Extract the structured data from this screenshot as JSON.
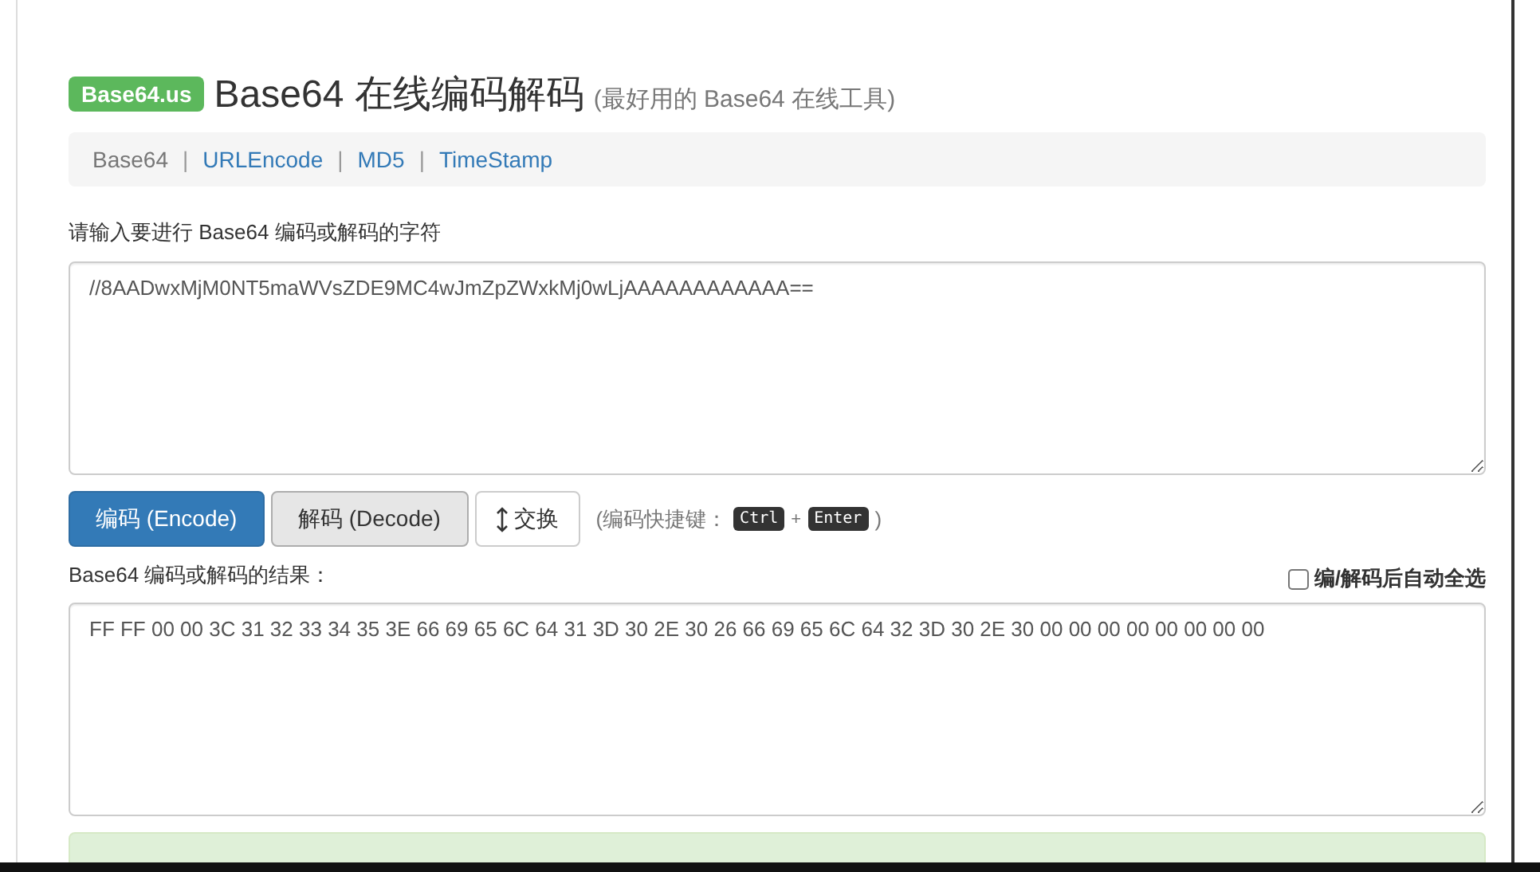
{
  "header": {
    "badge": "Base64.us",
    "title": "Base64 在线编码解码",
    "subtitle": "(最好用的 Base64 在线工具)"
  },
  "nav": [
    {
      "label": "Base64",
      "selected": true
    },
    {
      "label": "URLEncode",
      "selected": false
    },
    {
      "label": "MD5",
      "selected": false
    },
    {
      "label": "TimeStamp",
      "selected": false
    }
  ],
  "nav_separator": "|",
  "input": {
    "label": "请输入要进行 Base64 编码或解码的字符",
    "value": "//8AADwxMjM0NT5maWVsZDE9MC4wJmZpZWxkMj0wLjAAAAAAAAAAAA=="
  },
  "buttons": [
    {
      "label": "编码 (Encode)",
      "kind": "primary"
    },
    {
      "label": "解码 (Decode)",
      "kind": "default"
    },
    {
      "label": "交换",
      "kind": "swap"
    }
  ],
  "shortcut": {
    "prefix": "(编码快捷键：",
    "keys": [
      "Ctrl",
      "Enter"
    ],
    "plus": "+",
    "suffix": ")"
  },
  "output": {
    "label": "Base64 编码或解码的结果：",
    "auto_select": {
      "label": "编/解码后自动全选",
      "checked": false
    },
    "value": "FF FF 00 00 3C 31 32 33 34 35 3E 66 69 65 6C 64 31 3D 30 2E 30 26 66 69 65 6C 64 32 3D 30 2E 30 00 00 00 00 00 00 00 00"
  },
  "result_alert": {
    "kind": "success"
  }
}
